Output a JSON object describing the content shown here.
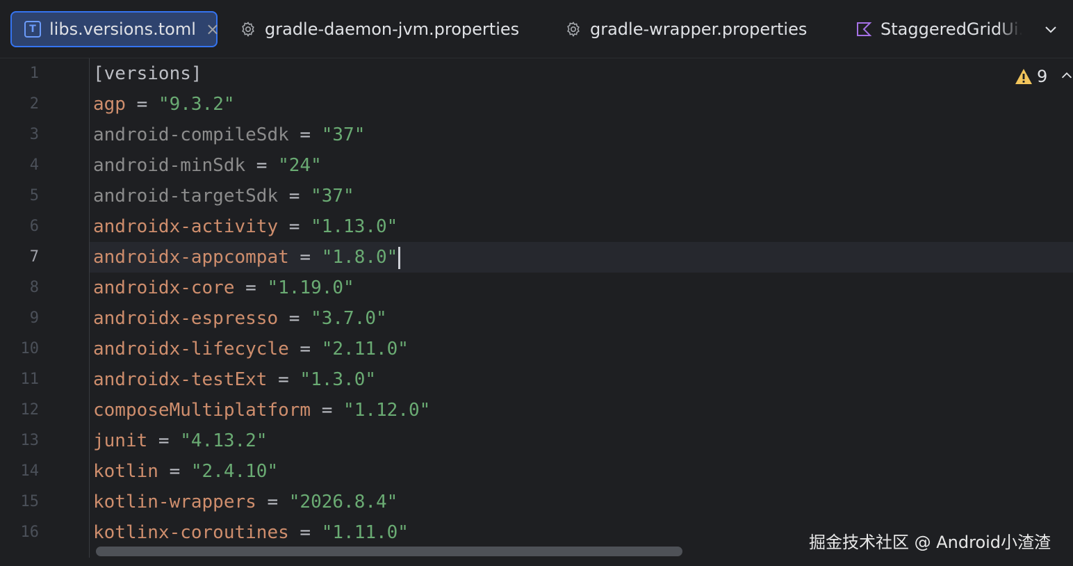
{
  "tabs": [
    {
      "label": "libs.versions.toml",
      "icon": "toml-file-icon",
      "active": true,
      "icon_glyph": "T"
    },
    {
      "label": "gradle-daemon-jvm.properties",
      "icon": "gear-icon",
      "active": false
    },
    {
      "label": "gradle-wrapper.properties",
      "icon": "gear-icon",
      "active": false
    },
    {
      "label": "StaggeredGridUi.",
      "icon": "kotlin-file-icon",
      "active": false
    }
  ],
  "inspection": {
    "warning_count": "9",
    "icon": "warning-icon"
  },
  "editor": {
    "current_line": 7,
    "lines": [
      {
        "num": "1",
        "section": "[versions]"
      },
      {
        "num": "2",
        "key": "agp",
        "eq": " = ",
        "value": "\"9.3.2\""
      },
      {
        "num": "3",
        "key": "android-compileSdk",
        "eq": " = ",
        "value": "\"37\""
      },
      {
        "num": "4",
        "key": "android-minSdk",
        "eq": " = ",
        "value": "\"24\""
      },
      {
        "num": "5",
        "key": "android-targetSdk",
        "eq": " = ",
        "value": "\"37\""
      },
      {
        "num": "6",
        "key": "androidx-activity",
        "eq": " = ",
        "value": "\"1.13.0\""
      },
      {
        "num": "7",
        "key": "androidx-appcompat",
        "eq": " = ",
        "value": "\"1.8.0\""
      },
      {
        "num": "8",
        "key": "androidx-core",
        "eq": " = ",
        "value": "\"1.19.0\""
      },
      {
        "num": "9",
        "key": "androidx-espresso",
        "eq": " = ",
        "value": "\"3.7.0\""
      },
      {
        "num": "10",
        "key": "androidx-lifecycle",
        "eq": " = ",
        "value": "\"2.11.0\""
      },
      {
        "num": "11",
        "key": "androidx-testExt",
        "eq": " = ",
        "value": "\"1.3.0\""
      },
      {
        "num": "12",
        "key": "composeMultiplatform",
        "eq": " = ",
        "value": "\"1.12.0\""
      },
      {
        "num": "13",
        "key": "junit",
        "eq": " = ",
        "value": "\"4.13.2\""
      },
      {
        "num": "14",
        "key": "kotlin",
        "eq": " = ",
        "value": "\"2.4.10\""
      },
      {
        "num": "15",
        "key": "kotlin-wrappers",
        "eq": " = ",
        "value": "\"2026.8.4\""
      },
      {
        "num": "16",
        "key": "kotlinx-coroutines",
        "eq": " = ",
        "value": "\"1.11.0\""
      }
    ]
  },
  "watermark": "掘金技术社区 @ Android小渣渣",
  "colors": {
    "background": "#1e1f22",
    "active_tab_bg": "#2e436e",
    "active_tab_border": "#3574f0",
    "key": "#cf8e6d",
    "key_unused": "#8c8c8c",
    "string": "#6aab73",
    "warning": "#f2c55c"
  }
}
